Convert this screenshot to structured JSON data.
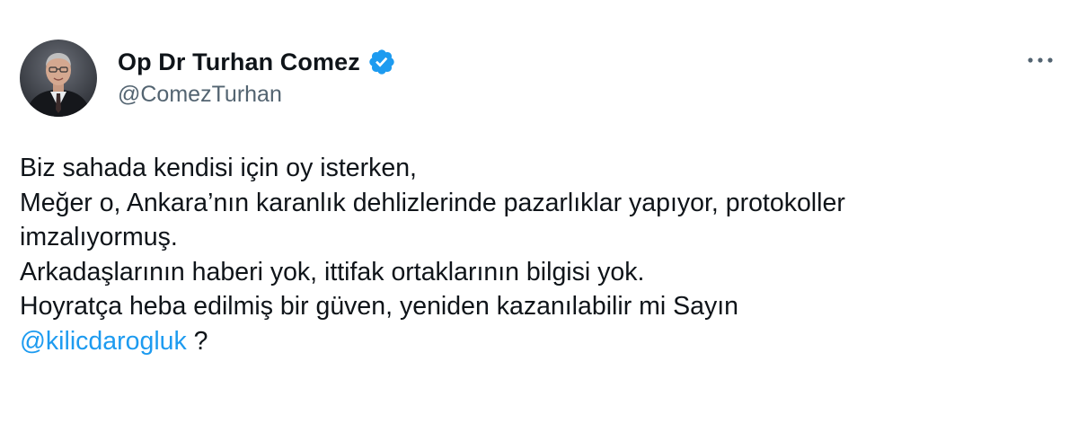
{
  "author": {
    "display_name": "Op Dr Turhan Comez",
    "handle": "@ComezTurhan",
    "verified": true,
    "avatar_icon": "profile-photo"
  },
  "more_icon": "more-horizontal-icon",
  "colors": {
    "text": "#0f1419",
    "secondary": "#536471",
    "accent": "#1d9bf0",
    "background": "#ffffff"
  },
  "tweet": {
    "lines": [
      "Biz sahada kendisi için oy isterken,",
      "Meğer o, Ankara’nın karanlık dehlizlerinde pazarlıklar yapıyor, protokoller",
      "imzalıyormuş.",
      "Arkadaşlarının haberi yok, ittifak ortaklarının bilgisi yok.",
      "Hoyratça heba edilmiş bir güven, yeniden kazanılabilir mi Sayın"
    ],
    "mention": "@kilicdarogluk",
    "after_mention": " ?"
  }
}
